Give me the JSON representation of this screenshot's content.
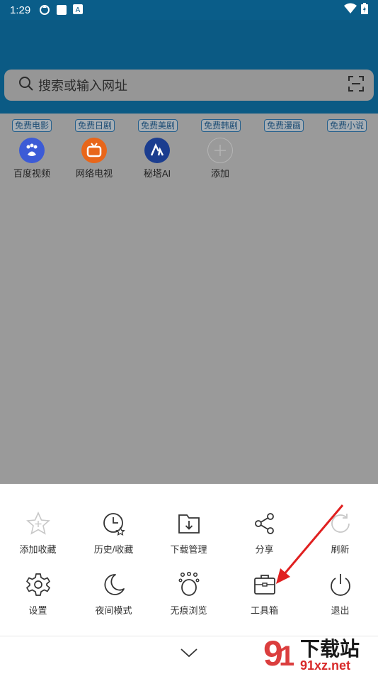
{
  "status_bar": {
    "time": "1:29"
  },
  "search": {
    "placeholder": "搜索或输入网址"
  },
  "tags": [
    "免费电影",
    "免费日剧",
    "免费美剧",
    "免费韩剧",
    "免费漫画",
    "免费小说"
  ],
  "shortcuts": [
    {
      "label": "百度视频",
      "icon": "baidu-video-icon",
      "color": "#3c5bd6"
    },
    {
      "label": "网络电视",
      "icon": "tv-icon",
      "color": "#e8661a"
    },
    {
      "label": "秘塔AI",
      "icon": "metaso-ai-icon",
      "color": "#1b3d8f"
    },
    {
      "label": "添加",
      "icon": "add-icon",
      "color": "#9a9a9a"
    }
  ],
  "menu": [
    {
      "label": "添加收藏",
      "icon": "star-add-icon"
    },
    {
      "label": "历史/收藏",
      "icon": "history-icon"
    },
    {
      "label": "下载管理",
      "icon": "download-folder-icon"
    },
    {
      "label": "分享",
      "icon": "share-icon"
    },
    {
      "label": "刷新",
      "icon": "refresh-icon"
    },
    {
      "label": "设置",
      "icon": "gear-icon"
    },
    {
      "label": "夜间模式",
      "icon": "moon-icon"
    },
    {
      "label": "无痕浏览",
      "icon": "incognito-icon"
    },
    {
      "label": "工具箱",
      "icon": "toolbox-icon"
    },
    {
      "label": "退出",
      "icon": "power-icon"
    }
  ],
  "watermark": {
    "text": "下载站",
    "domain": "91xz.net"
  },
  "colors": {
    "accent": "#0b5a84",
    "annotation_arrow": "#e02020"
  }
}
